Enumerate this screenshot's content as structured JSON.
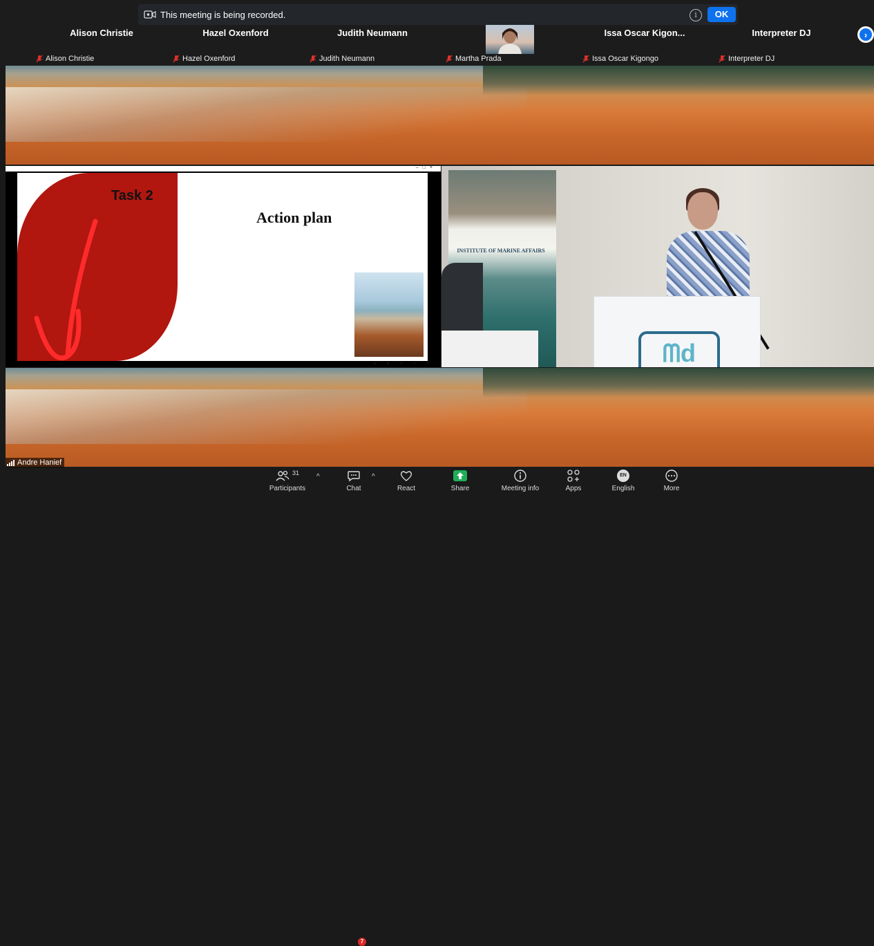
{
  "recording_banner": {
    "text": "This meeting is being recorded.",
    "ok_label": "OK",
    "info_icon": "info-icon"
  },
  "gallery": {
    "tiles": [
      {
        "name": "Alison Christie",
        "label": "Alison Christie"
      },
      {
        "name": "Hazel Oxenford",
        "label": "Hazel Oxenford"
      },
      {
        "name": "Judith Neumann",
        "label": "Judith Neumann"
      },
      {
        "name": "",
        "label": "Martha Prada"
      },
      {
        "name": "Issa Oscar Kigon...",
        "label": "Issa Oscar Kigongo"
      },
      {
        "name": "Interpreter DJ",
        "label": "Interpreter DJ"
      }
    ],
    "next_icon": "chevron-right-icon"
  },
  "slide": {
    "task": "Task 2",
    "title": "Action plan"
  },
  "speaker_video": {
    "banner_text": "INSTITUTE OF MARINE AFFAIRS"
  },
  "active_speaker": "Andre Hanief",
  "toolbar": {
    "participants_label": "Participants",
    "participants_count": "31",
    "chat_label": "Chat",
    "chat_badge": "7",
    "react_label": "React",
    "share_label": "Share",
    "meeting_info_label": "Meeting info",
    "apps_label": "Apps",
    "language_code": "EN",
    "language_label": "English",
    "more_label": "More"
  },
  "colors": {
    "accent": "#0e72ed",
    "share_green": "#1fae57",
    "badge_red": "#e02828",
    "mute_red": "#e0312b"
  }
}
